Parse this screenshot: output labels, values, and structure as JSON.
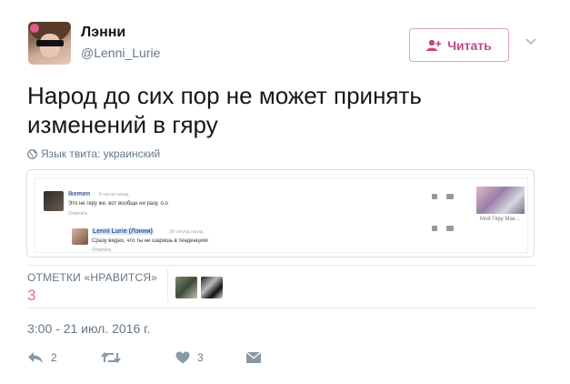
{
  "author": {
    "name": "Лэнни",
    "handle": "@Lenni_Lurie"
  },
  "follow_button": {
    "label": "Читать"
  },
  "tweet": {
    "text": "Народ до сих пор не может принять изменений в гяру",
    "language_note": "Язык твита: украинский",
    "timestamp": "3:00 - 21 июл. 2016 г."
  },
  "embedded_image": {
    "comment1": {
      "author": "Ikemen",
      "time": "8 часов назад",
      "text": "Это не гяру же, вот вообще ни разу. о.о",
      "reply": "Ответить"
    },
    "comment2": {
      "author": "Lenni Lurie (Лэнни)",
      "time": "38 секунд назад",
      "text": "Сразу видно, что ты не шаришь в тенденциях",
      "reply": "Ответить"
    },
    "side_caption": "Мой Гяру Мак..."
  },
  "likes": {
    "label": "ОТМЕТКИ «НРАВИТСЯ»",
    "count": "3"
  },
  "actions": {
    "reply_count": "2",
    "like_count": "3"
  },
  "colors": {
    "accent_pink": "#c5478a",
    "like_count": "#e26aa5",
    "muted": "#657786"
  },
  "icons": [
    "add-user-icon",
    "chevron-down-icon",
    "globe-icon",
    "reply-icon",
    "retweet-icon",
    "heart-icon",
    "direct-message-icon"
  ]
}
